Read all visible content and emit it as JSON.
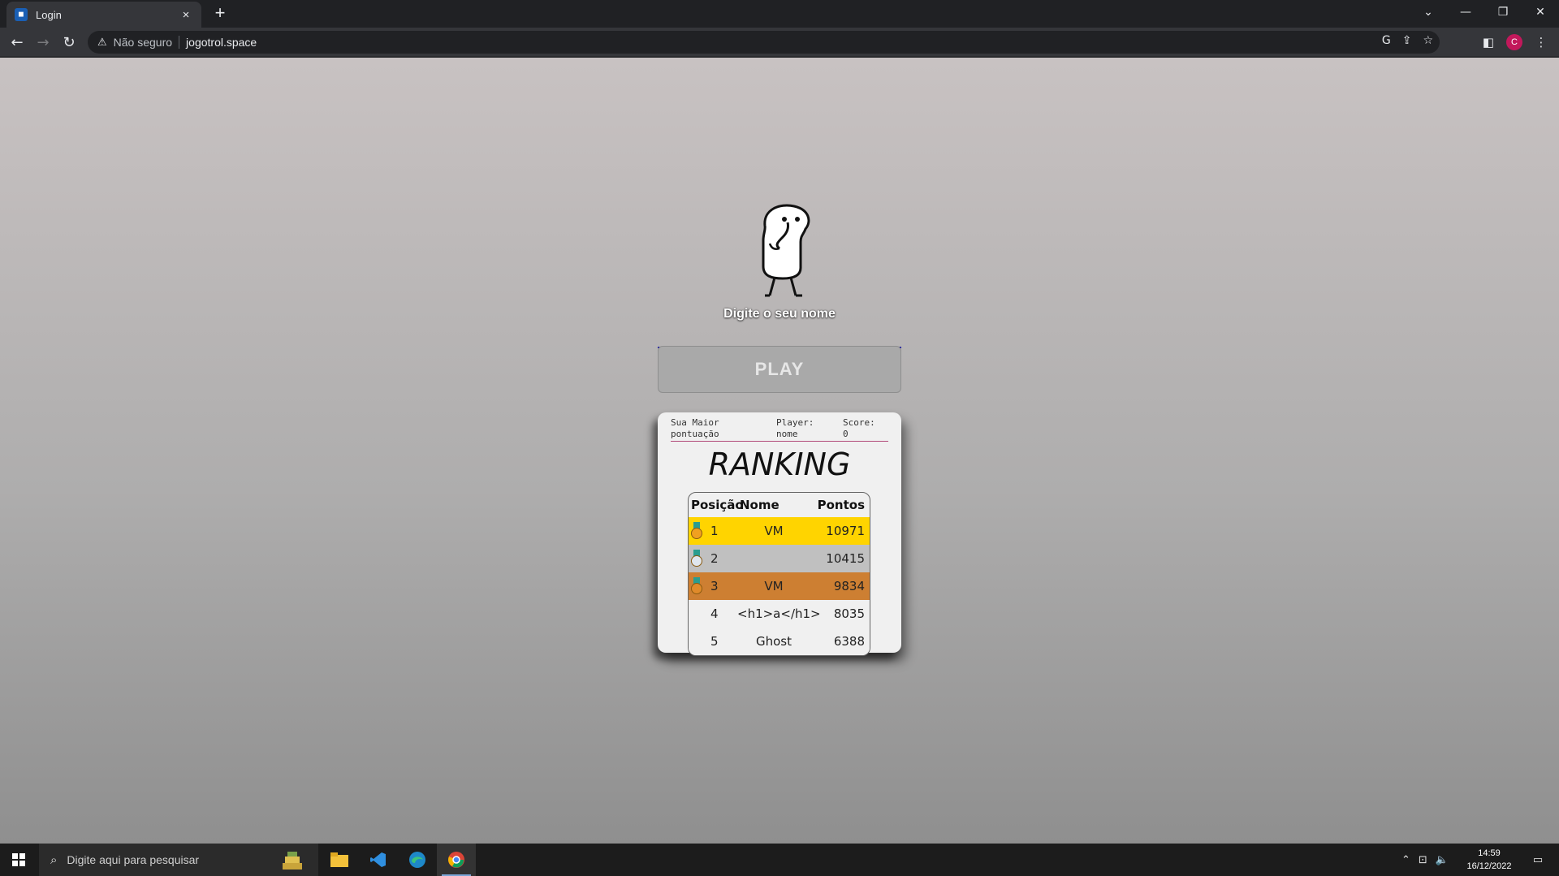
{
  "browser": {
    "tab_title": "Login",
    "tab_close": "×",
    "new_tab": "+",
    "security_text": "Não seguro",
    "url": "jogotrol.space",
    "profile_initial": "C"
  },
  "page": {
    "prompt_label": "Digite o seu nome",
    "name_input_value": "",
    "play_label": "PLAY",
    "best_score": {
      "label": "Sua Maior pontuação",
      "player_label": "Player:",
      "player_value": "nome",
      "score_label": "Score:",
      "score_value": "0"
    },
    "ranking_title": "RANKING",
    "table_headers": {
      "position": "Posição",
      "name": "Nome",
      "points": "Pontos"
    },
    "rows": [
      {
        "pos": "1",
        "name": "VM",
        "points": "10971",
        "bg": "#ffd400",
        "medal": "gold"
      },
      {
        "pos": "2",
        "name": "",
        "points": "10415",
        "bg": "#c0c0c0",
        "medal": "silver"
      },
      {
        "pos": "3",
        "name": "VM",
        "points": "9834",
        "bg": "#cd7f32",
        "medal": "bronze"
      },
      {
        "pos": "4",
        "name": "<h1>a</h1>",
        "points": "8035",
        "bg": "#f0f0f0",
        "medal": "none"
      },
      {
        "pos": "5",
        "name": "Ghost",
        "points": "6388",
        "bg": "#f0f0f0",
        "medal": "none"
      }
    ]
  },
  "taskbar": {
    "search_placeholder": "Digite aqui para pesquisar",
    "time": "14:59",
    "date": "16/12/2022"
  }
}
